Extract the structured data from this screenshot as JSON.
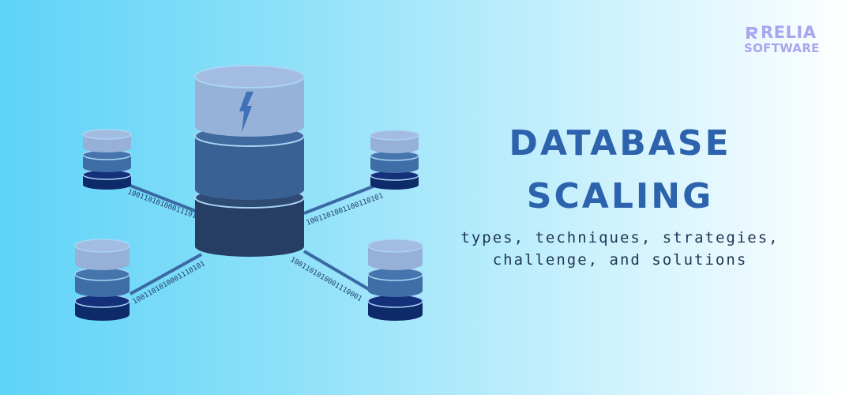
{
  "brand": {
    "name": "RELIA",
    "tagline": "SOFTWARE"
  },
  "headline": {
    "line1": "DATABASE",
    "line2": "SCALING"
  },
  "subheading": {
    "line1": "types, techniques, strategies,",
    "line2": "challenge, and solutions"
  },
  "binary_labels": {
    "top_left": "1001101010001110101",
    "top_right": "1001101001100110101",
    "bottom_left": "1001101010001110101",
    "bottom_right": "1001101010001110001"
  },
  "colors": {
    "cylinder_top": "#9db5dc",
    "cylinder_mid": "#3f6ea7",
    "cylinder_base": "#17306b",
    "headline": "#2d63ad",
    "brand": "#a9a5ee"
  }
}
